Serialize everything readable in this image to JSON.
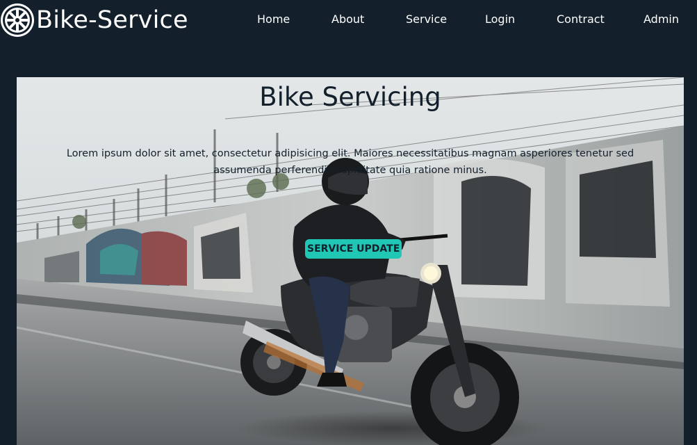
{
  "nav": {
    "brand": "Bike-Service",
    "links": [
      {
        "label": "Home"
      },
      {
        "label": "About"
      },
      {
        "label": "Service"
      },
      {
        "label": "Login"
      },
      {
        "label": "Contract"
      },
      {
        "label": "Admin"
      }
    ]
  },
  "hero": {
    "title": "Bike Servicing",
    "description": "Lorem ipsum dolor sit amet, consectetur adipisicing elit. Maiores necessitatibus magnam asperiores tenetur sed assumenda perferendis cupiditate quia ratione minus.",
    "cta_label": "SERVICE UPDATE",
    "background_image": "motorcyclist riding past graffiti wall"
  },
  "colors": {
    "page_bg": "#13202b",
    "nav_text": "#ffffff",
    "hero_text": "#13202b",
    "accent": "#1fc7b4"
  },
  "icons": {
    "logo": "gear-wheel-icon"
  }
}
